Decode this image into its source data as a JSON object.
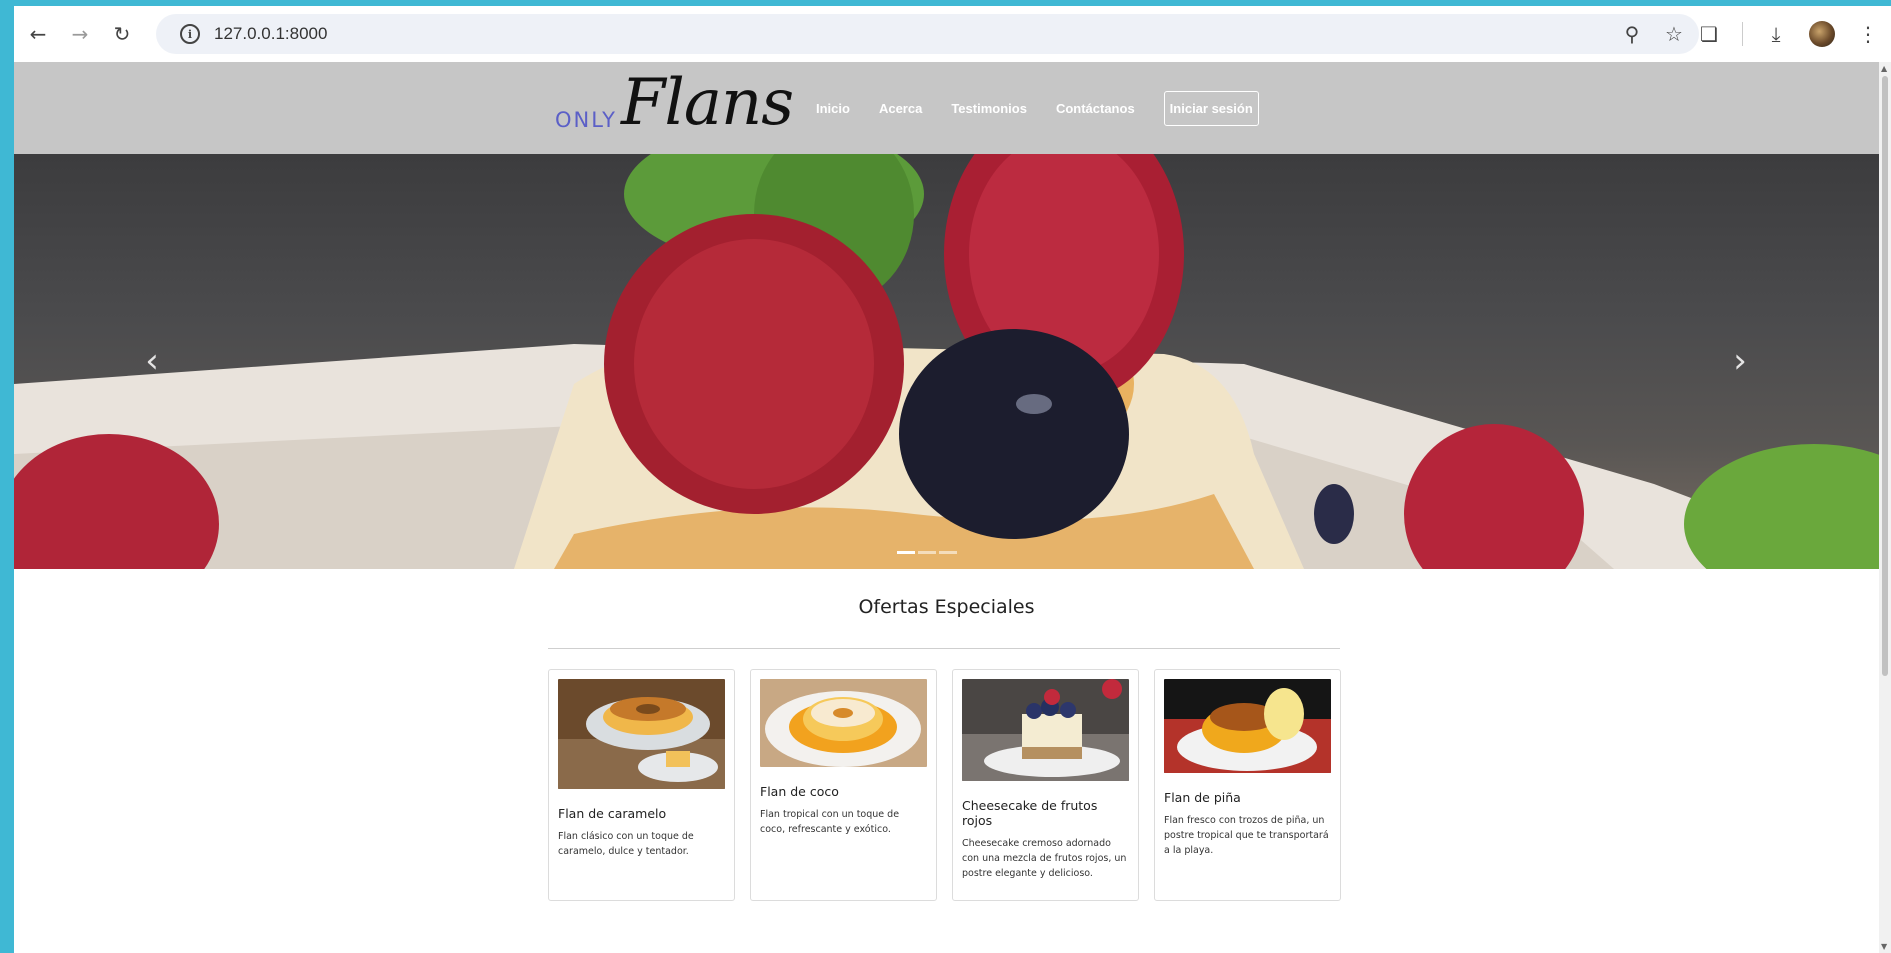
{
  "browser": {
    "url": "127.0.0.1:8000",
    "icons": [
      "back-arrow-icon",
      "forward-arrow-icon",
      "reload-icon",
      "info-icon",
      "zoom-icon",
      "star-icon",
      "extensions-icon",
      "download-icon",
      "profile-avatar",
      "menu-icon"
    ]
  },
  "site": {
    "logo_only": "ONLY",
    "logo_flans": "Flans",
    "nav": [
      "Inicio",
      "Acerca",
      "Testimonios",
      "Contáctanos"
    ],
    "login": "Iniciar sesión"
  },
  "carousel": {
    "prev": "‹",
    "next": "›",
    "slides": 3,
    "active_slide": 1
  },
  "offers": {
    "title": "Ofertas Especiales",
    "cards": [
      {
        "title": "Flan de caramelo",
        "desc": "Flan clásico con un toque de caramelo, dulce y tentador."
      },
      {
        "title": "Flan de coco",
        "desc": "Flan tropical con un toque de coco, refrescante y exótico."
      },
      {
        "title": "Cheesecake de frutos rojos",
        "desc": "Cheesecake cremoso adornado con una mezcla de frutos rojos, un postre elegante y delicioso."
      },
      {
        "title": "Flan de piña",
        "desc": "Flan fresco con trozos de piña, un postre tropical que te transportará a la playa."
      }
    ]
  },
  "colors": {
    "frame": "#3fb8d4",
    "navbar": "#c6c6c6",
    "logo_accent": "#5b5fc7"
  }
}
